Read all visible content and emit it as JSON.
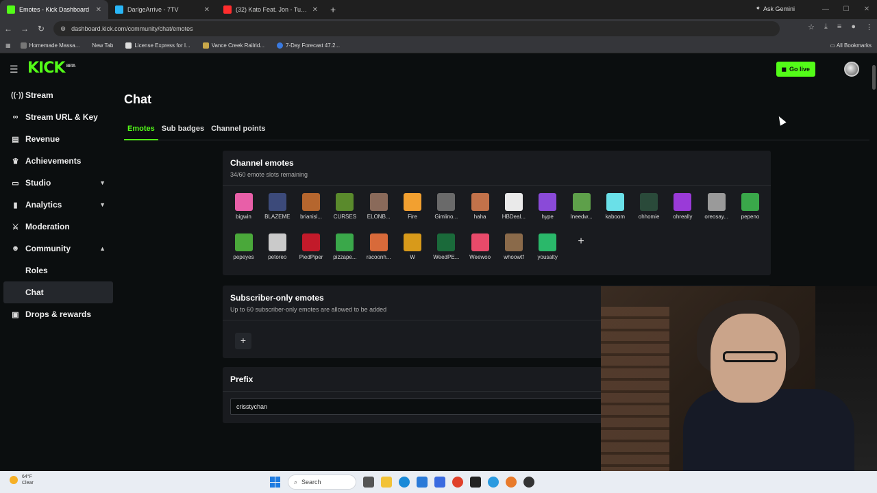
{
  "browser": {
    "tabs": [
      {
        "title": "Emotes - Kick Dashboard",
        "color": "#53fc18",
        "active": true
      },
      {
        "title": "DarlgeArrive - 7TV",
        "color": "#29b6f6",
        "active": false
      },
      {
        "title": "(32) Kato Feat. Jon - Turn T",
        "color": "#ff2d2d",
        "active": false
      }
    ],
    "new_tab": "+",
    "ask_gemini": "Ask Gemini",
    "url": "dashboard.kick.com/community/chat/emotes",
    "bookmarks": [
      "Homemade Massa...",
      "New Tab",
      "License Express for I...",
      "Vance Creek Railrid...",
      "7-Day Forecast 47.2..."
    ],
    "all_bookmarks": "All Bookmarks"
  },
  "header": {
    "logo": "KICK",
    "logo_badge": "BETA",
    "go_live": "Go live"
  },
  "sidebar": {
    "items": [
      {
        "label": "Stream",
        "icon": "broadcast-icon"
      },
      {
        "label": "Stream URL & Key",
        "icon": "link-icon"
      },
      {
        "label": "Revenue",
        "icon": "revenue-icon"
      },
      {
        "label": "Achievements",
        "icon": "trophy-icon"
      },
      {
        "label": "Studio",
        "icon": "studio-icon"
      },
      {
        "label": "Analytics",
        "icon": "analytics-icon"
      },
      {
        "label": "Moderation",
        "icon": "sword-icon"
      },
      {
        "label": "Community",
        "icon": "community-icon"
      },
      {
        "label": "Roles"
      },
      {
        "label": "Chat"
      },
      {
        "label": "Drops & rewards",
        "icon": "gift-icon"
      }
    ]
  },
  "main": {
    "title": "Chat",
    "tabs": [
      "Emotes",
      "Sub badges",
      "Channel points"
    ],
    "channel_emotes": {
      "title": "Channel emotes",
      "subtitle": "34/60 emote slots remaining",
      "emotes": [
        {
          "name": "bigwin",
          "color": "#e85fa8"
        },
        {
          "name": "BLAZEME",
          "color": "#3c4a7a"
        },
        {
          "name": "brianisl...",
          "color": "#b5662e"
        },
        {
          "name": "CURSES",
          "color": "#5a8a2c"
        },
        {
          "name": "ELONB...",
          "color": "#8a6a5a"
        },
        {
          "name": "Fire",
          "color": "#f2a030"
        },
        {
          "name": "Gimlino...",
          "color": "#6a6a6a"
        },
        {
          "name": "haha",
          "color": "#c2724a"
        },
        {
          "name": "HBDeal...",
          "color": "#eaeaea"
        },
        {
          "name": "hype",
          "color": "#8a4ad8"
        },
        {
          "name": "Ineedw...",
          "color": "#5ea04a"
        },
        {
          "name": "kaboom",
          "color": "#6ae0e8"
        },
        {
          "name": "ohhomie",
          "color": "#2a4a3a"
        },
        {
          "name": "ohreally",
          "color": "#9a3ad8"
        },
        {
          "name": "oreosay...",
          "color": "#9a9a9a"
        },
        {
          "name": "pepeno",
          "color": "#3aa84a"
        },
        {
          "name": "pepeyes",
          "color": "#4aa83a"
        },
        {
          "name": "petoreo",
          "color": "#cacaca"
        },
        {
          "name": "PiedPiper",
          "color": "#c21a2a"
        },
        {
          "name": "pizzape...",
          "color": "#3aa84a"
        },
        {
          "name": "racoonh...",
          "color": "#d86a3a"
        },
        {
          "name": "W",
          "color": "#d89a1a"
        },
        {
          "name": "WeedPE...",
          "color": "#1a6a3a"
        },
        {
          "name": "Weewoo",
          "color": "#e84a6a"
        },
        {
          "name": "whoowtf",
          "color": "#8a6a4a"
        },
        {
          "name": "yousalty",
          "color": "#2ab86a"
        }
      ],
      "add": "+"
    },
    "subscriber_emotes": {
      "title": "Subscriber-only emotes",
      "subtitle": "Up to 60 subscriber-only emotes are allowed to be added",
      "add": "+"
    },
    "prefix": {
      "title": "Prefix",
      "value": "crisstychan"
    }
  },
  "taskbar": {
    "weather_temp": "64°F",
    "weather_desc": "Clear",
    "search": "Search"
  }
}
